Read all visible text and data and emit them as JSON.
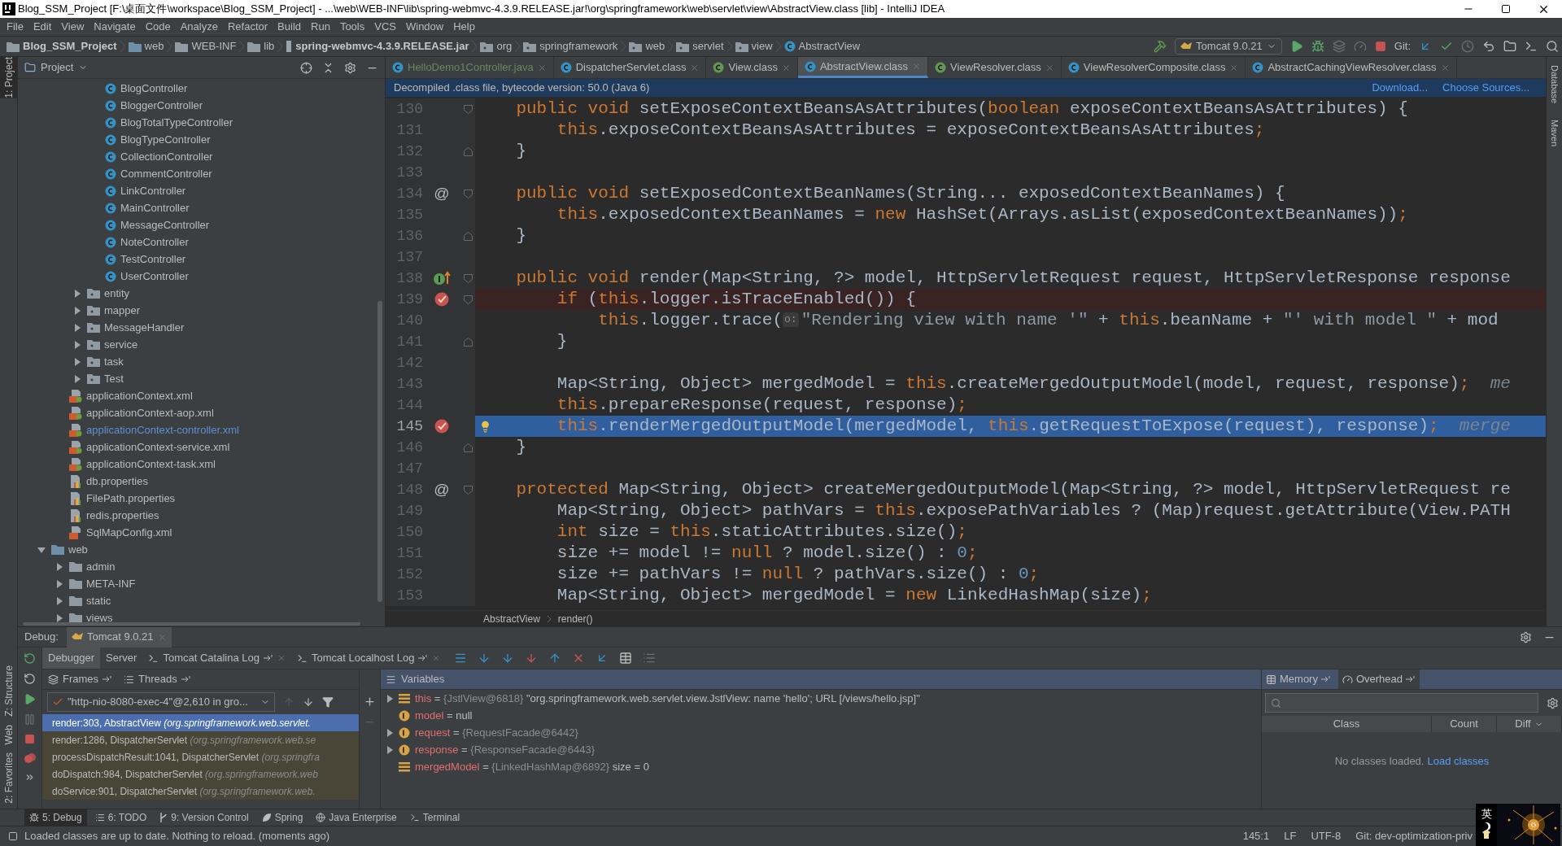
{
  "window": {
    "title": "Blog_SSM_Project [F:\\桌面文件\\workspace\\Blog_SSM_Project] - ...\\web\\WEB-INF\\lib\\spring-webmvc-4.3.9.RELEASE.jar!\\org\\springframework\\web\\servlet\\view\\AbstractView.class [lib] - IntelliJ IDEA"
  },
  "menu": [
    "File",
    "Edit",
    "View",
    "Navigate",
    "Code",
    "Analyze",
    "Refactor",
    "Build",
    "Run",
    "Tools",
    "VCS",
    "Window",
    "Help"
  ],
  "breadcrumbs": [
    {
      "label": "Blog_SSM_Project",
      "kind": "project"
    },
    {
      "label": "web",
      "kind": "module"
    },
    {
      "label": "WEB-INF",
      "kind": "folder"
    },
    {
      "label": "lib",
      "kind": "folder"
    },
    {
      "label": "spring-webmvc-4.3.9.RELEASE.jar",
      "kind": "jar"
    },
    {
      "label": "org",
      "kind": "package"
    },
    {
      "label": "springframework",
      "kind": "package"
    },
    {
      "label": "web",
      "kind": "package"
    },
    {
      "label": "servlet",
      "kind": "package"
    },
    {
      "label": "view",
      "kind": "package"
    },
    {
      "label": "AbstractView",
      "kind": "class"
    }
  ],
  "run_config": "Tomcat 9.0.21",
  "git_label": "Git:",
  "left_side_tabs": [
    {
      "label": "1: Project",
      "selected": true
    },
    {
      "label": "Z: Structure",
      "selected": false
    },
    {
      "label": "Web",
      "selected": false
    },
    {
      "label": "2: Favorites",
      "selected": false
    }
  ],
  "right_side_tabs": [
    "Database",
    "Maven"
  ],
  "project_panel": {
    "title": "Project",
    "tree": [
      {
        "children": [
          {
            "children": [
              {
                "children": [
                  {
                    "label": "BlogController",
                    "kind": "class",
                    "modified": false
                  },
                  {
                    "label": "BloggerController",
                    "kind": "class",
                    "modified": false
                  },
                  {
                    "label": "BlogTotalTypeController",
                    "kind": "class",
                    "modified": false
                  },
                  {
                    "label": "BlogTypeController",
                    "kind": "class",
                    "modified": false
                  },
                  {
                    "label": "CollectionController",
                    "kind": "class",
                    "modified": false
                  },
                  {
                    "label": "CommentController",
                    "kind": "class",
                    "modified": false
                  },
                  {
                    "label": "LinkController",
                    "kind": "class",
                    "modified": false
                  },
                  {
                    "label": "MainController",
                    "kind": "class",
                    "modified": false
                  },
                  {
                    "label": "MessageController",
                    "kind": "class",
                    "modified": false
                  },
                  {
                    "label": "NoteController",
                    "kind": "class",
                    "modified": false
                  },
                  {
                    "label": "TestController",
                    "kind": "class",
                    "modified": false
                  },
                  {
                    "label": "UserController",
                    "kind": "class",
                    "modified": false
                  }
                ]
              },
              {
                "label": "entity",
                "kind": "package",
                "expanded": false
              },
              {
                "label": "mapper",
                "kind": "package",
                "expanded": false
              },
              {
                "label": "MessageHandler",
                "kind": "package",
                "expanded": false
              },
              {
                "label": "service",
                "kind": "package",
                "expanded": false
              },
              {
                "label": "task",
                "kind": "package",
                "expanded": false
              },
              {
                "label": "Test",
                "kind": "package",
                "expanded": false
              }
            ]
          },
          {
            "label": "applicationContext.xml",
            "kind": "spring-xml",
            "modified": false
          },
          {
            "label": "applicationContext-aop.xml",
            "kind": "spring-xml",
            "modified": false
          },
          {
            "label": "applicationContext-controller.xml",
            "kind": "spring-xml",
            "modified": true
          },
          {
            "label": "applicationContext-service.xml",
            "kind": "spring-xml",
            "modified": false
          },
          {
            "label": "applicationContext-task.xml",
            "kind": "spring-xml",
            "modified": false
          },
          {
            "label": "db.properties",
            "kind": "properties",
            "modified": false
          },
          {
            "label": "FilePath.properties",
            "kind": "properties",
            "modified": false
          },
          {
            "label": "redis.properties",
            "kind": "properties",
            "modified": false
          },
          {
            "label": "SqlMapConfig.xml",
            "kind": "xml",
            "modified": false
          }
        ]
      },
      {
        "label": "web",
        "kind": "web-folder",
        "expanded": true,
        "children": [
          {
            "label": "admin",
            "kind": "folder",
            "expanded": false
          },
          {
            "label": "META-INF",
            "kind": "folder",
            "expanded": false
          },
          {
            "label": "static",
            "kind": "folder",
            "expanded": false
          },
          {
            "label": "views",
            "kind": "folder",
            "expanded": false
          }
        ]
      }
    ]
  },
  "editor_tabs": [
    {
      "label": "HelloDemo1Controller.java",
      "kind": "java",
      "selected": false
    },
    {
      "label": "DispatcherServlet.class",
      "kind": "class",
      "selected": false
    },
    {
      "label": "View.class",
      "kind": "interface",
      "selected": false
    },
    {
      "label": "AbstractView.class",
      "kind": "class",
      "selected": true
    },
    {
      "label": "ViewResolver.class",
      "kind": "interface",
      "selected": false
    },
    {
      "label": "ViewResolverComposite.class",
      "kind": "class",
      "selected": false
    },
    {
      "label": "AbstractCachingViewResolver.class",
      "kind": "class",
      "selected": false
    }
  ],
  "banner": {
    "text": "Decompiled .class file, bytecode version: 50.0 (Java 6)",
    "links": [
      "Download...",
      "Choose Sources..."
    ]
  },
  "code_lines": [
    {
      "number": "130",
      "kind": "normal",
      "marker": {
        "kind": "none"
      },
      "fold": {
        "kind": "start"
      },
      "tokens": [
        {
          "kind": "keyword",
          "text": "    public void "
        },
        {
          "kind": "plain",
          "text": "setExposeContextBeansAsAttributes("
        },
        {
          "kind": "keyword",
          "text": "boolean "
        },
        {
          "kind": "plain",
          "text": "exposeContextBeansAsAttributes) {"
        }
      ]
    },
    {
      "number": "131",
      "kind": "normal",
      "marker": {
        "kind": "none"
      },
      "fold": {
        "kind": "none"
      },
      "tokens": [
        {
          "kind": "keyword",
          "text": "        this"
        },
        {
          "kind": "plain",
          "text": ".exposeContextBeansAsAttributes = exposeContextBeansAsAttributes"
        },
        {
          "kind": "keyword",
          "text": ";"
        }
      ]
    },
    {
      "number": "132",
      "kind": "normal",
      "marker": {
        "kind": "none"
      },
      "fold": {
        "kind": "end"
      },
      "tokens": [
        {
          "kind": "plain",
          "text": "    }"
        }
      ]
    },
    {
      "number": "133",
      "kind": "normal",
      "marker": {
        "kind": "none"
      },
      "fold": {
        "kind": "none"
      }
    },
    {
      "number": "134",
      "kind": "normal",
      "marker": {
        "kind": "annotation",
        "text": "@"
      },
      "fold": {
        "kind": "start"
      },
      "tokens": [
        {
          "kind": "keyword",
          "text": "    public void "
        },
        {
          "kind": "plain",
          "text": "setExposedContextBeanNames(String... exposedContextBeanNames) {"
        }
      ]
    },
    {
      "number": "135",
      "kind": "normal",
      "marker": {
        "kind": "none"
      },
      "fold": {
        "kind": "none"
      },
      "tokens": [
        {
          "kind": "keyword",
          "text": "        this"
        },
        {
          "kind": "plain",
          "text": ".exposedContextBeanNames = "
        },
        {
          "kind": "keyword",
          "text": "new "
        },
        {
          "kind": "plain",
          "text": "HashSet(Arrays.asList(exposedContextBeanNames))"
        },
        {
          "kind": "keyword",
          "text": ";"
        }
      ]
    },
    {
      "number": "136",
      "kind": "normal",
      "marker": {
        "kind": "none"
      },
      "fold": {
        "kind": "end"
      },
      "tokens": [
        {
          "kind": "plain",
          "text": "    }"
        }
      ]
    },
    {
      "number": "137",
      "kind": "normal",
      "marker": {
        "kind": "none"
      },
      "fold": {
        "kind": "none"
      }
    },
    {
      "number": "138",
      "kind": "normal",
      "marker": {
        "kind": "implements"
      },
      "fold": {
        "kind": "start"
      },
      "tokens": [
        {
          "kind": "keyword",
          "text": "    public void "
        },
        {
          "kind": "plain",
          "text": "render(Map<String, ?> model, HttpServletRequest request, HttpServletResponse response"
        }
      ]
    },
    {
      "number": "139",
      "kind": "breakpoint",
      "marker": {
        "kind": "breakpoint"
      },
      "fold": {
        "kind": "start"
      },
      "tokens": [
        {
          "kind": "keyword",
          "text": "        if "
        },
        {
          "kind": "plain",
          "text": "("
        },
        {
          "kind": "keyword",
          "text": "this"
        },
        {
          "kind": "plain",
          "text": ".logger.isTraceEnabled()) {"
        }
      ]
    },
    {
      "number": "140",
      "kind": "normal",
      "marker": {
        "kind": "none"
      },
      "fold": {
        "kind": "none"
      },
      "tokens": [
        {
          "kind": "keyword",
          "text": "            this"
        },
        {
          "kind": "plain",
          "text": ".logger.trace("
        },
        {
          "kind": "hint",
          "text": "o:"
        },
        {
          "kind": "string",
          "text": "\"Rendering view with name '\""
        },
        {
          "kind": "plain",
          "text": " + "
        },
        {
          "kind": "keyword",
          "text": "this"
        },
        {
          "kind": "plain",
          "text": ".beanName + "
        },
        {
          "kind": "string",
          "text": "\"' with model \""
        },
        {
          "kind": "plain",
          "text": " + mod"
        }
      ]
    },
    {
      "number": "141",
      "kind": "normal",
      "marker": {
        "kind": "none"
      },
      "fold": {
        "kind": "end"
      },
      "tokens": [
        {
          "kind": "plain",
          "text": "        }"
        }
      ]
    },
    {
      "number": "142",
      "kind": "normal",
      "marker": {
        "kind": "none"
      },
      "fold": {
        "kind": "none"
      }
    },
    {
      "number": "143",
      "kind": "normal",
      "marker": {
        "kind": "none"
      },
      "fold": {
        "kind": "none"
      },
      "tokens": [
        {
          "kind": "plain",
          "text": "        Map<String, Object> mergedModel = "
        },
        {
          "kind": "keyword",
          "text": "this"
        },
        {
          "kind": "plain",
          "text": ".createMergedOutputModel(model, request, response)"
        },
        {
          "kind": "keyword",
          "text": ";"
        },
        {
          "kind": "inline_value",
          "text": "me"
        }
      ]
    },
    {
      "number": "144",
      "kind": "normal",
      "marker": {
        "kind": "none"
      },
      "fold": {
        "kind": "none"
      },
      "tokens": [
        {
          "kind": "keyword",
          "text": "        this"
        },
        {
          "kind": "plain",
          "text": ".prepareResponse(request, response)"
        },
        {
          "kind": "keyword",
          "text": ";"
        }
      ]
    },
    {
      "number": "145",
      "kind": "current",
      "marker": {
        "kind": "breakpoint"
      },
      "fold": {
        "kind": "none"
      },
      "tokens": [
        {
          "kind": "keyword",
          "text": "        this"
        },
        {
          "kind": "plain",
          "text": ".renderMergedOutputModel(mergedModel, "
        },
        {
          "kind": "keyword",
          "text": "this"
        },
        {
          "kind": "plain",
          "text": ".getRequestToExpose(request), response)"
        },
        {
          "kind": "keyword",
          "text": ";"
        },
        {
          "kind": "inline_value",
          "text": "merge"
        }
      ]
    },
    {
      "number": "146",
      "kind": "normal",
      "marker": {
        "kind": "none"
      },
      "fold": {
        "kind": "end"
      },
      "tokens": [
        {
          "kind": "plain",
          "text": "    }"
        }
      ]
    },
    {
      "number": "147",
      "kind": "normal",
      "marker": {
        "kind": "none"
      },
      "fold": {
        "kind": "none"
      }
    },
    {
      "number": "148",
      "kind": "normal",
      "marker": {
        "kind": "annotation",
        "text": "@"
      },
      "fold": {
        "kind": "start"
      },
      "tokens": [
        {
          "kind": "keyword",
          "text": "    protected "
        },
        {
          "kind": "plain",
          "text": "Map<String, Object> createMergedOutputModel(Map<String, ?> model, HttpServletRequest re"
        }
      ]
    },
    {
      "number": "149",
      "kind": "normal",
      "marker": {
        "kind": "none"
      },
      "fold": {
        "kind": "none"
      },
      "tokens": [
        {
          "kind": "plain",
          "text": "        Map<String, Object> pathVars = "
        },
        {
          "kind": "keyword",
          "text": "this"
        },
        {
          "kind": "plain",
          "text": ".exposePathVariables ? (Map)request.getAttribute(View.PATH"
        }
      ]
    },
    {
      "number": "150",
      "kind": "normal",
      "marker": {
        "kind": "none"
      },
      "fold": {
        "kind": "none"
      },
      "tokens": [
        {
          "kind": "keyword",
          "text": "        int "
        },
        {
          "kind": "plain",
          "text": "size = "
        },
        {
          "kind": "keyword",
          "text": "this"
        },
        {
          "kind": "plain",
          "text": ".staticAttributes.size()"
        },
        {
          "kind": "keyword",
          "text": ";"
        }
      ]
    },
    {
      "number": "151",
      "kind": "normal",
      "marker": {
        "kind": "none"
      },
      "fold": {
        "kind": "none"
      },
      "tokens": [
        {
          "kind": "plain",
          "text": "        size += model != "
        },
        {
          "kind": "keyword",
          "text": "null "
        },
        {
          "kind": "plain",
          "text": "? model.size() : "
        },
        {
          "kind": "number",
          "text": "0"
        },
        {
          "kind": "keyword",
          "text": ";"
        }
      ]
    },
    {
      "number": "152",
      "kind": "normal",
      "marker": {
        "kind": "none"
      },
      "fold": {
        "kind": "none"
      },
      "tokens": [
        {
          "kind": "plain",
          "text": "        size += pathVars != "
        },
        {
          "kind": "keyword",
          "text": "null "
        },
        {
          "kind": "plain",
          "text": "? pathVars.size() : "
        },
        {
          "kind": "number",
          "text": "0"
        },
        {
          "kind": "keyword",
          "text": ";"
        }
      ]
    },
    {
      "number": "153",
      "kind": "normal",
      "marker": {
        "kind": "none"
      },
      "fold": {
        "kind": "none"
      },
      "tokens": [
        {
          "kind": "plain",
          "text": "        Map<String, Object> mergedModel = "
        },
        {
          "kind": "keyword",
          "text": "new "
        },
        {
          "kind": "plain",
          "text": "LinkedHashMap(size)"
        },
        {
          "kind": "keyword",
          "text": ";"
        }
      ]
    }
  ],
  "editor_breadcrumbs": [
    "AbstractView",
    "render()"
  ],
  "debug": {
    "label": "Debug:",
    "session_tab": "Tomcat 9.0.21",
    "tabs": [
      {
        "label": "Debugger",
        "kind": "plain",
        "selected": true
      },
      {
        "label": "Server",
        "kind": "plain",
        "selected": false
      },
      {
        "label": "Tomcat Catalina Log",
        "kind": "log",
        "selected": false
      },
      {
        "label": "Tomcat Localhost Log",
        "kind": "log",
        "selected": false
      }
    ],
    "frames_tabs": [
      "Frames",
      "Threads"
    ],
    "thread": "\"http-nio-8080-exec-4\"@2,610 in gro...",
    "frames": [
      {
        "method": "render:303, AbstractView",
        "location": "(org.springframework.web.servlet.",
        "kind": "user",
        "selected": true
      },
      {
        "method": "render:1286, DispatcherServlet",
        "location": "(org.springframework.web.se",
        "kind": "library",
        "selected": false
      },
      {
        "method": "processDispatchResult:1041, DispatcherServlet",
        "location": "(org.springfra",
        "kind": "library",
        "selected": false
      },
      {
        "method": "doDispatch:984, DispatcherServlet",
        "location": "(org.springframework.web",
        "kind": "library",
        "selected": false
      },
      {
        "method": "doService:901, DispatcherServlet",
        "location": "(org.springframework.web.",
        "kind": "library",
        "selected": false
      }
    ],
    "variables_title": "Variables",
    "variables": [
      {
        "name": "this",
        "op": "=",
        "ref": "{JstlView@6818}",
        "value": "\"org.springframework.web.servlet.view.JstlView: name 'hello'; URL [/views/hello.jsp]\"",
        "kind": "field",
        "expandable": true
      },
      {
        "name": "model",
        "op": "=",
        "value": "null",
        "kind": "param",
        "expandable": false
      },
      {
        "name": "request",
        "op": "=",
        "ref": "{RequestFacade@6442}",
        "kind": "param",
        "expandable": true
      },
      {
        "name": "response",
        "op": "=",
        "ref": "{ResponseFacade@6443}",
        "kind": "param",
        "expandable": true
      },
      {
        "name": "mergedModel",
        "op": "=",
        "ref": "{LinkedHashMap@6892}",
        "value": "size = 0",
        "kind": "field",
        "expandable": false
      }
    ],
    "memory_tabs": [
      "Memory",
      "Overhead"
    ],
    "memory_columns": [
      "Class",
      "Count",
      "Diff"
    ],
    "memory_empty": "No classes loaded.",
    "memory_link": "Load classes"
  },
  "tool_tabs": [
    {
      "label": "5: Debug",
      "kind": "debug",
      "selected": true
    },
    {
      "label": "6: TODO",
      "kind": "todo",
      "selected": false
    },
    {
      "label": "9: Version Control",
      "kind": "vcs",
      "selected": false
    },
    {
      "label": "Spring",
      "kind": "spring",
      "selected": false
    },
    {
      "label": "Java Enterprise",
      "kind": "enterprise",
      "selected": false
    },
    {
      "label": "Terminal",
      "kind": "terminal",
      "selected": false
    }
  ],
  "status_bar": {
    "message": "Loaded classes are up to date. Nothing to reload. (moments ago)",
    "position": "145:1",
    "line_separator": "LF",
    "encoding": "UTF-8",
    "branch": "Git: dev-optimization-priv"
  },
  "ime_widget": {
    "label": "英"
  }
}
